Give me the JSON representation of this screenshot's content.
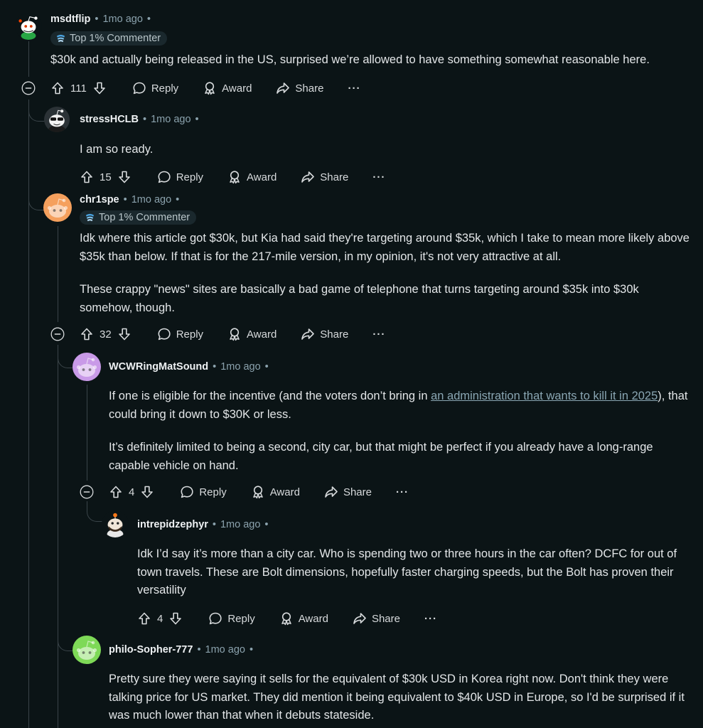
{
  "comments": [
    {
      "username": "msdtflip",
      "time": "1mo ago",
      "flair": "Top 1% Commenter",
      "body": [
        "$30k and actually being released in the US, surprised we’re allowed to have something somewhat reasonable here."
      ],
      "votes": "111"
    },
    {
      "username": "stressHCLB",
      "time": "1mo ago",
      "body": [
        "I am so ready."
      ],
      "votes": "15"
    },
    {
      "username": "chr1spe",
      "time": "1mo ago",
      "flair": "Top 1% Commenter",
      "body": [
        "Idk where this article got $30k, but Kia had said they're targeting around $35k, which I take to mean more likely above $35k than below. If that is for the 217-mile version, in my opinion, it's not very attractive at all.",
        "These crappy \"news\" sites are basically a bad game of telephone that turns targeting around $35k into $30k somehow, though."
      ],
      "votes": "32"
    },
    {
      "username": "WCWRingMatSound",
      "time": "1mo ago",
      "body_pre": "If one is eligible for the incentive (and the voters don’t bring in ",
      "body_link": "an administration that wants to kill it in 2025",
      "body_post": "), that could bring it down to $30K or less.",
      "body2": "It’s definitely limited to being a second, city car, but that might be perfect if you already have a long-range capable vehicle on hand.",
      "votes": "4"
    },
    {
      "username": "intrepidzephyr",
      "time": "1mo ago",
      "body": [
        "Idk I’d say it’s more than a city car. Who is spending two or three hours in the car often? DCFC for out of town travels. These are Bolt dimensions, hopefully faster charging speeds, but the Bolt has proven their versatility"
      ],
      "votes": "4"
    },
    {
      "username": "philo-Sopher-777",
      "time": "1mo ago",
      "body": [
        "Pretty sure they were saying it sells for the equivalent of $30k USD in Korea right now. Don't think they were talking price for US market. They did mention it being equivalent to $40k USD in Europe, so I'd be surprised if it was much lower than that when it debuts stateside."
      ]
    }
  ],
  "labels": {
    "reply": "Reply",
    "award": "Award",
    "share": "Share",
    "more": "···",
    "dot": "•"
  },
  "colors": {
    "background": "#0b1416",
    "thread_line": "#3a4449",
    "link": "#8aa6b3",
    "flair_bg": "#1a282d"
  },
  "icons": [
    "collapse-icon",
    "upvote-icon",
    "downvote-icon",
    "reply-icon",
    "award-icon",
    "share-icon",
    "more-icon",
    "flair-icon"
  ]
}
